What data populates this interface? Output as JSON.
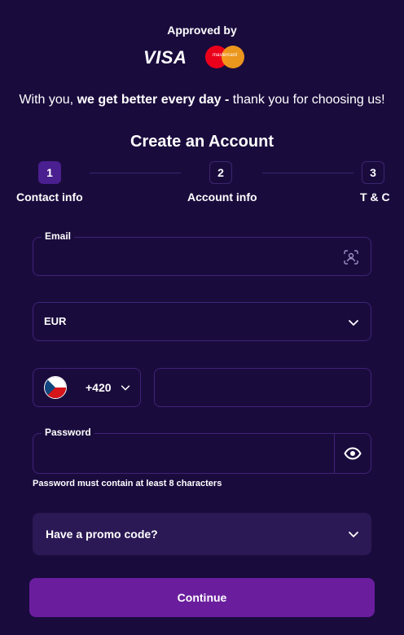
{
  "header": {
    "approved_by": "Approved by",
    "visa": "VISA",
    "mastercard": "mastercard",
    "tagline_pre": "With you, ",
    "tagline_bold": "we get better every day -",
    "tagline_post": " thank you for choosing us!"
  },
  "form": {
    "title": "Create an Account",
    "steps": [
      {
        "number": "1",
        "label": "Contact info",
        "active": true
      },
      {
        "number": "2",
        "label": "Account info",
        "active": false
      },
      {
        "number": "3",
        "label": "T & C",
        "active": false
      }
    ],
    "email": {
      "label": "Email",
      "value": ""
    },
    "currency": {
      "value": "EUR"
    },
    "phone": {
      "country_code": "+420",
      "country": "Czech Republic",
      "value": ""
    },
    "password": {
      "label": "Password",
      "value": "",
      "hint": "Password must contain at least 8 characters"
    },
    "promo": {
      "label": "Have a promo code?"
    },
    "continue_label": "Continue"
  },
  "icons": {
    "email_action": "face-scan-icon",
    "currency_dropdown": "chevron-down-icon",
    "password_toggle": "eye-icon",
    "promo_toggle": "chevron-down-icon"
  },
  "colors": {
    "background": "#1a0b3d",
    "accent": "#6a1e9e",
    "active_step": "#4a1f8f",
    "border": "#3d2378",
    "promo_bg": "#2b1955"
  }
}
